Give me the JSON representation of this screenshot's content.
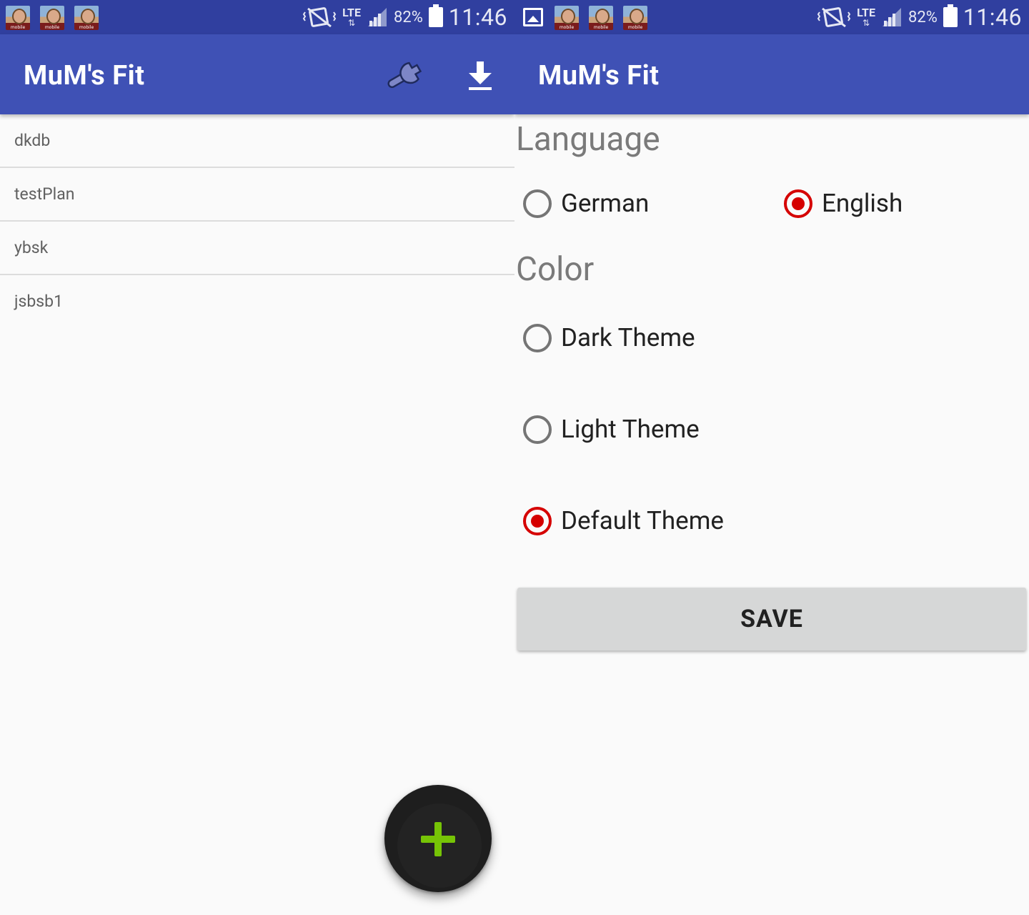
{
  "status_bar": {
    "battery": "82%",
    "time": "11:46",
    "network": "LTE",
    "notification_icon_text": "mobile"
  },
  "left_screen": {
    "app_title": "MuM's Fit",
    "toolbar_icons": [
      "wrench-icon",
      "download-icon"
    ],
    "plans": [
      "dkdb",
      "testPlan",
      "ybsk",
      "jsbsb1"
    ],
    "fab_icon": "plus-icon"
  },
  "right_screen": {
    "app_title": "MuM's Fit",
    "language": {
      "title": "Language",
      "options": [
        {
          "label": "German",
          "checked": false
        },
        {
          "label": "English",
          "checked": true
        }
      ]
    },
    "color": {
      "title": "Color",
      "options": [
        {
          "label": "Dark Theme",
          "checked": false
        },
        {
          "label": "Light Theme",
          "checked": false
        },
        {
          "label": "Default Theme",
          "checked": true
        }
      ]
    },
    "save_label": "SAVE"
  },
  "colors": {
    "status_bar": "#303f9f",
    "app_bar": "#3f51b5",
    "radio_checked": "#d50000",
    "fab_plus": "#76c406"
  }
}
